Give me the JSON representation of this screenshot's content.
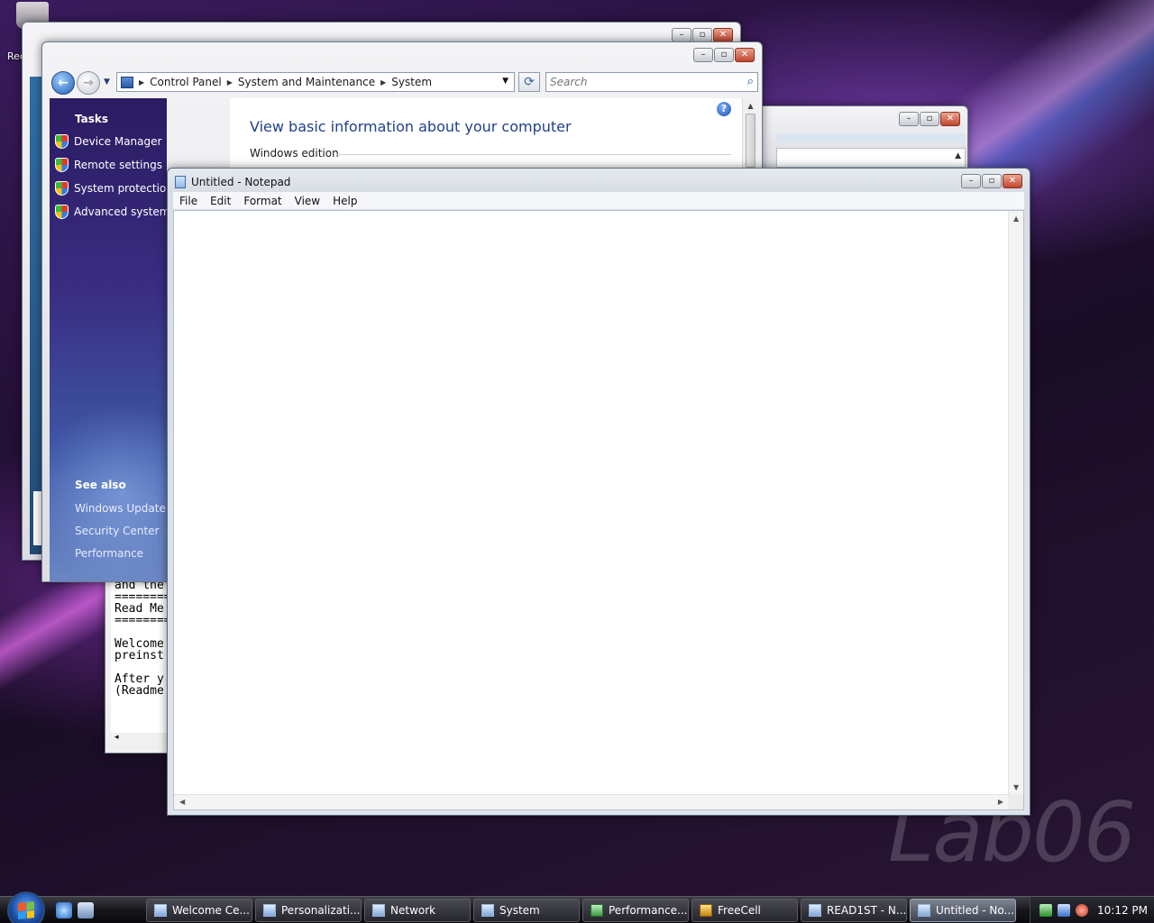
{
  "desktop": {
    "recycle_bin_label": "Rec",
    "watermark": "Lab06"
  },
  "system_window": {
    "breadcrumbs": [
      "Control Panel",
      "System and Maintenance",
      "System"
    ],
    "search_placeholder": "Search",
    "tasks_heading": "Tasks",
    "tasks": [
      "Device Manager",
      "Remote settings",
      "System protection",
      "Advanced system s"
    ],
    "see_also_heading": "See also",
    "see_also": [
      "Windows Update",
      "Security Center",
      "Performance"
    ],
    "main_heading": "View basic information about your computer",
    "section_label": "Windows edition",
    "help_glyph": "?"
  },
  "readme_window": {
    "lines": [
      "and the",
      "========",
      "Read Me",
      "========",
      "",
      "Welcome",
      "preinst",
      "",
      "After y",
      "(Readme"
    ]
  },
  "notepad": {
    "title": "Untitled - Notepad",
    "menu": [
      "File",
      "Edit",
      "Format",
      "View",
      "Help"
    ],
    "content": ""
  },
  "taskbar": {
    "buttons": [
      {
        "label": "Welcome Ce...",
        "icon": "welcome-center-icon"
      },
      {
        "label": "Personalizati...",
        "icon": "personalization-icon"
      },
      {
        "label": "Network",
        "icon": "network-icon"
      },
      {
        "label": "System",
        "icon": "system-icon"
      },
      {
        "label": "Performance...",
        "icon": "performance-icon"
      },
      {
        "label": "FreeCell",
        "icon": "freecell-icon"
      },
      {
        "label": "READ1ST - N...",
        "icon": "notepad-icon"
      },
      {
        "label": "Untitled - No...",
        "icon": "notepad-icon",
        "active": true
      }
    ],
    "clock": "10:12 PM"
  }
}
